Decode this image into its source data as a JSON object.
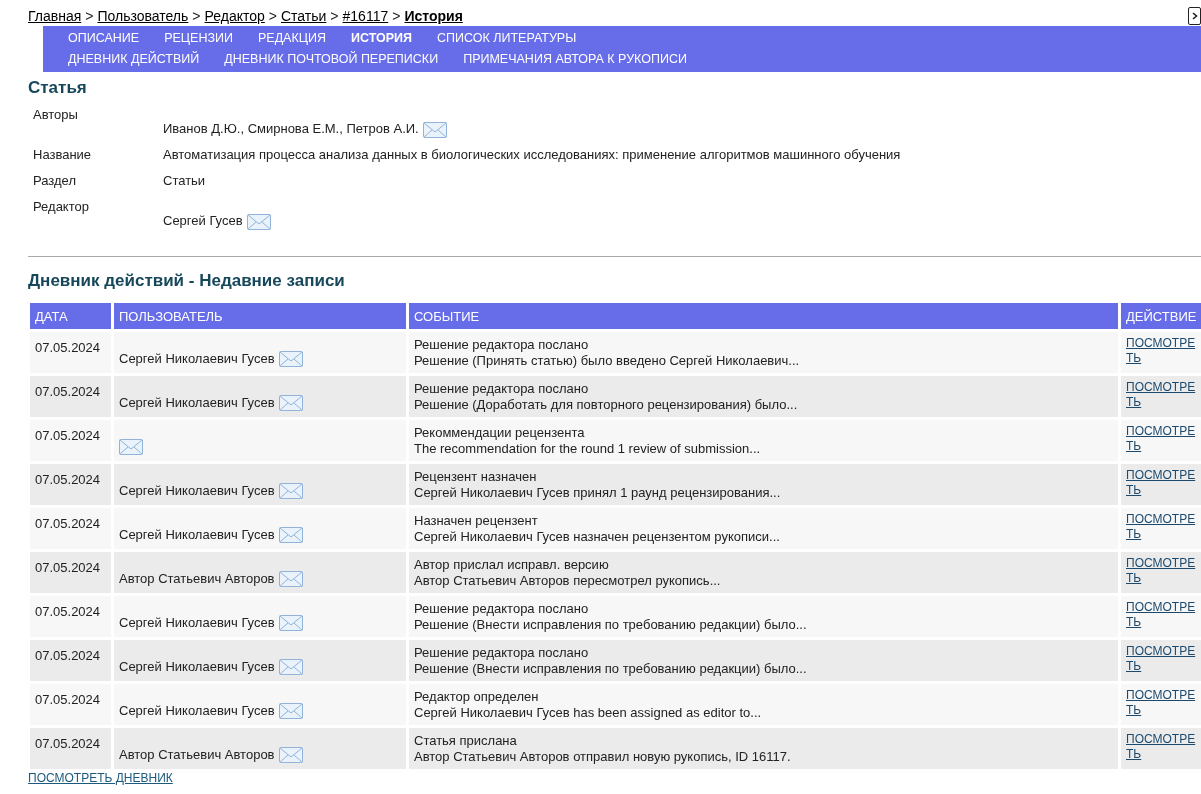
{
  "breadcrumb": [
    {
      "kind": "link",
      "label": "Главная"
    },
    {
      "kind": "separator",
      "label": ">"
    },
    {
      "kind": "link",
      "label": "Пользователь"
    },
    {
      "kind": "separator",
      "label": ">"
    },
    {
      "kind": "link",
      "label": "Редактор"
    },
    {
      "kind": "separator",
      "label": ">"
    },
    {
      "kind": "link",
      "label": "Статьи"
    },
    {
      "kind": "separator",
      "label": ">"
    },
    {
      "kind": "link",
      "label": "#16117"
    },
    {
      "kind": "separator",
      "label": ">"
    },
    {
      "kind": "current",
      "label": "История"
    }
  ],
  "tabs": [
    [
      {
        "label": "ОПИСАНИЕ",
        "selected": false
      },
      {
        "label": "РЕЦЕНЗИИ",
        "selected": false
      },
      {
        "label": "РЕДАКЦИЯ",
        "selected": false
      },
      {
        "label": "ИСТОРИЯ",
        "selected": true
      },
      {
        "label": "СПИСОК ЛИТЕРАТУРЫ",
        "selected": false
      }
    ],
    [
      {
        "label": "ДНЕВНИК ДЕЙСТВИЙ",
        "selected": false
      },
      {
        "label": "ДНЕВНИК ПОЧТОВОЙ ПЕРЕПИСКИ",
        "selected": false
      },
      {
        "label": "ПРИМЕЧАНИЯ АВТОРА К РУКОПИСИ",
        "selected": false
      }
    ]
  ],
  "article": {
    "title": "Статья",
    "fields": [
      {
        "kind": "contact",
        "label": "Авторы",
        "value": "Иванов Д.Ю., Смирнова Е.М., Петров А.И."
      },
      {
        "kind": "text",
        "label": "Название",
        "value": "Автоматизация процесса анализа данных в биологических исследованиях: применение алгоритмов машинного обучения"
      },
      {
        "kind": "text",
        "label": "Раздел",
        "value": "Статьи"
      },
      {
        "kind": "contact",
        "label": "Редактор",
        "value": "Сергей Гусев"
      }
    ]
  },
  "log": {
    "title": "Дневник действий - Недавние записи",
    "columns": [
      "ДАТА",
      "ПОЛЬЗОВАТЕЛЬ",
      "СОБЫТИЕ",
      "ДЕЙСТВИЕ"
    ],
    "rows": [
      {
        "date": "07.05.2024",
        "user": "Сергей Николаевич Гусев",
        "event": "Решение редактора послано",
        "detail": "Решение (Принять статью) было введено Сергей Николаевич...",
        "action": "ПОСМОТРЕТЬ"
      },
      {
        "date": "07.05.2024",
        "user": "Сергей Николаевич Гусев",
        "event": "Решение редактора послано",
        "detail": "Решение (Доработать для повторного рецензирования) было...",
        "action": "ПОСМОТРЕТЬ"
      },
      {
        "date": "07.05.2024",
        "user": "",
        "event": "Рекоммендации рецензента",
        "detail": "The recommendation for the round 1 review of submission...",
        "action": "ПОСМОТРЕТЬ"
      },
      {
        "date": "07.05.2024",
        "user": "Сергей Николаевич Гусев",
        "event": "Рецензент назначен",
        "detail": "Сергей Николаевич Гусев принял 1 раунд рецензирования...",
        "action": "ПОСМОТРЕТЬ"
      },
      {
        "date": "07.05.2024",
        "user": "Сергей Николаевич Гусев",
        "event": "Назначен рецензент",
        "detail": "Сергей Николаевич Гусев назначен рецензентом рукописи...",
        "action": "ПОСМОТРЕТЬ"
      },
      {
        "date": "07.05.2024",
        "user": "Автор Статьевич Авторов",
        "event": "Автор прислал исправл. версию",
        "detail": "Автор Статьевич Авторов пересмотрел рукопись...",
        "action": "ПОСМОТРЕТЬ"
      },
      {
        "date": "07.05.2024",
        "user": "Сергей Николаевич Гусев",
        "event": "Решение редактора послано",
        "detail": "Решение (Внести исправления по требованию редакции) было...",
        "action": "ПОСМОТРЕТЬ"
      },
      {
        "date": "07.05.2024",
        "user": "Сергей Николаевич Гусев",
        "event": "Решение редактора послано",
        "detail": "Решение (Внести исправления по требованию редакции) было...",
        "action": "ПОСМОТРЕТЬ"
      },
      {
        "date": "07.05.2024",
        "user": "Сергей Николаевич Гусев",
        "event": "Редактор определен",
        "detail": "Сергей Николаевич Гусев has been assigned as editor to...",
        "action": "ПОСМОТРЕТЬ"
      },
      {
        "date": "07.05.2024",
        "user": "Автор Статьевич Авторов",
        "event": "Статья прислана",
        "detail": "Автор Статьевич Авторов отправил новую рукопись, ID 16117.",
        "action": "ПОСМОТРЕТЬ"
      }
    ],
    "footer_link": "ПОСМОТРЕТЬ ДНЕВНИК"
  }
}
